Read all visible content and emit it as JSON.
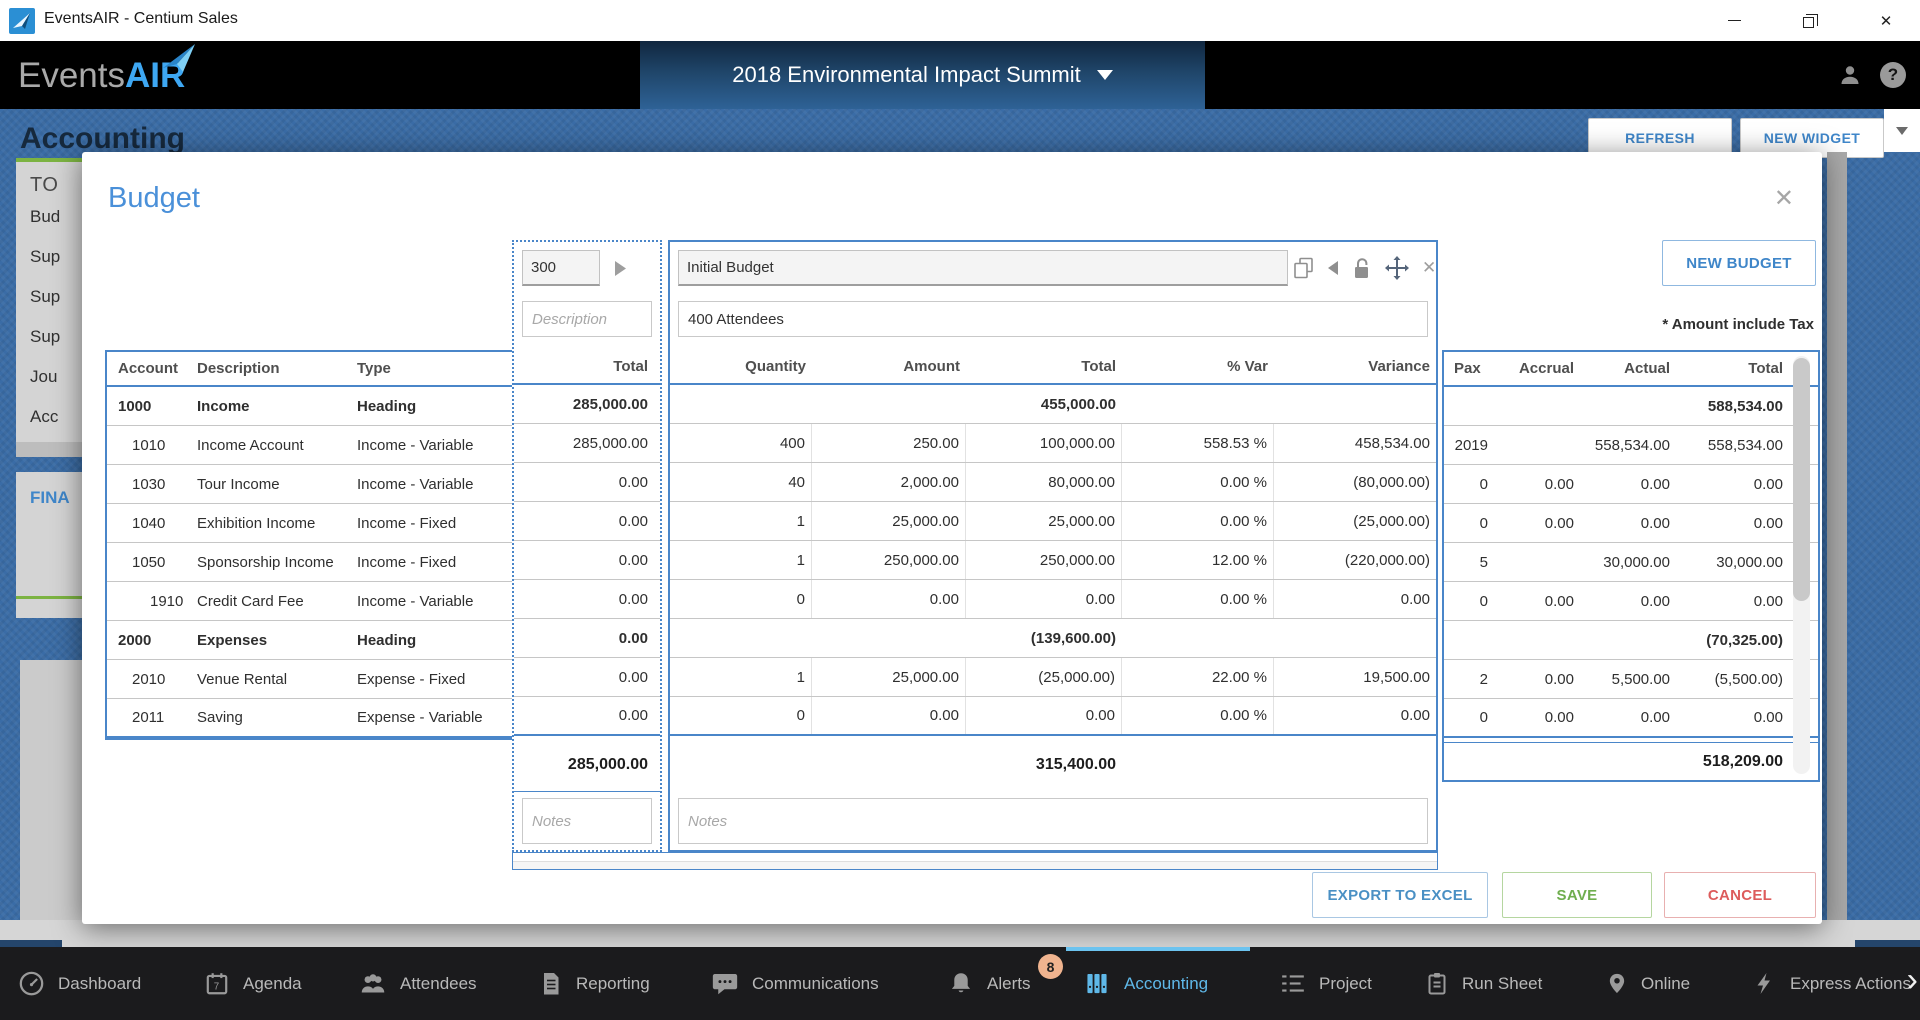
{
  "window": {
    "title": "EventsAIR - Centium Sales"
  },
  "app_header": {
    "logo_events": "Events",
    "logo_air": "AIR",
    "event_selector": "2018 Environmental Impact Summit"
  },
  "page": {
    "title": "Accounting",
    "refresh_label": "REFRESH",
    "new_widget_label": "NEW WIDGET",
    "left_cards": {
      "card1_heading": "TO",
      "card1_items": [
        "Bud",
        "Sup",
        "Sup",
        "Sup",
        "Jou",
        "Acc"
      ],
      "card2_heading": "FINA"
    }
  },
  "modal": {
    "title": "Budget",
    "close_glyph": "✕",
    "budget_code": "300",
    "budget_name": "Initial Budget",
    "budget_description": "400 Attendees",
    "description_placeholder": "Description",
    "notes_placeholder": "Notes",
    "new_budget_label": "NEW BUDGET",
    "tax_note": "* Amount include Tax",
    "buttons": {
      "export": "EXPORT TO EXCEL",
      "save": "SAVE",
      "cancel": "CANCEL"
    },
    "table": {
      "left_headers": [
        "Account",
        "Description",
        "Type"
      ],
      "total_header": "Total",
      "mid_headers": [
        "Quantity",
        "Amount",
        "Total",
        "% Var",
        "Variance"
      ],
      "right_headers": [
        "Pax",
        "Accrual",
        "Actual",
        "Total"
      ],
      "rows": [
        {
          "account": "1000",
          "description": "Income",
          "type": "Heading",
          "heading": true,
          "indent": 0,
          "total": "285,000.00",
          "qty": "",
          "amount": "",
          "mtotal": "455,000.00",
          "var_pct": "",
          "variance": "",
          "pax": "",
          "accrual": "",
          "actual": "",
          "rtotal": "588,534.00"
        },
        {
          "account": "1010",
          "description": "Income Account",
          "type": "Income - Variable",
          "heading": false,
          "indent": 1,
          "total": "285,000.00",
          "qty": "400",
          "amount": "250.00",
          "mtotal": "100,000.00",
          "var_pct": "558.53 %",
          "variance": "458,534.00",
          "pax": "2019",
          "accrual": "",
          "actual": "558,534.00",
          "rtotal": "558,534.00"
        },
        {
          "account": "1030",
          "description": "Tour Income",
          "type": "Income - Variable",
          "heading": false,
          "indent": 1,
          "total": "0.00",
          "qty": "40",
          "amount": "2,000.00",
          "mtotal": "80,000.00",
          "var_pct": "0.00 %",
          "variance": "(80,000.00)",
          "pax": "0",
          "accrual": "0.00",
          "actual": "0.00",
          "rtotal": "0.00"
        },
        {
          "account": "1040",
          "description": "Exhibition Income",
          "type": "Income - Fixed",
          "heading": false,
          "indent": 1,
          "total": "0.00",
          "qty": "1",
          "amount": "25,000.00",
          "mtotal": "25,000.00",
          "var_pct": "0.00 %",
          "variance": "(25,000.00)",
          "pax": "0",
          "accrual": "0.00",
          "actual": "0.00",
          "rtotal": "0.00"
        },
        {
          "account": "1050",
          "description": "Sponsorship Income",
          "type": "Income - Fixed",
          "heading": false,
          "indent": 1,
          "total": "0.00",
          "qty": "1",
          "amount": "250,000.00",
          "mtotal": "250,000.00",
          "var_pct": "12.00 %",
          "variance": "(220,000.00)",
          "pax": "5",
          "accrual": "",
          "actual": "30,000.00",
          "rtotal": "30,000.00"
        },
        {
          "account": "1910",
          "description": "Credit Card Fee",
          "type": "Income - Variable",
          "heading": false,
          "indent": 2,
          "total": "0.00",
          "qty": "0",
          "amount": "0.00",
          "mtotal": "0.00",
          "var_pct": "0.00 %",
          "variance": "0.00",
          "pax": "0",
          "accrual": "0.00",
          "actual": "0.00",
          "rtotal": "0.00"
        },
        {
          "account": "2000",
          "description": "Expenses",
          "type": "Heading",
          "heading": true,
          "indent": 0,
          "total": "0.00",
          "qty": "",
          "amount": "",
          "mtotal": "(139,600.00)",
          "var_pct": "",
          "variance": "",
          "pax": "",
          "accrual": "",
          "actual": "",
          "rtotal": "(70,325.00)"
        },
        {
          "account": "2010",
          "description": "Venue Rental",
          "type": "Expense - Fixed",
          "heading": false,
          "indent": 1,
          "total": "0.00",
          "qty": "1",
          "amount": "25,000.00",
          "mtotal": "(25,000.00)",
          "var_pct": "22.00 %",
          "variance": "19,500.00",
          "pax": "2",
          "accrual": "0.00",
          "actual": "5,500.00",
          "rtotal": "(5,500.00)"
        },
        {
          "account": "2011",
          "description": "Saving",
          "type": "Expense - Variable",
          "heading": false,
          "indent": 1,
          "total": "0.00",
          "qty": "0",
          "amount": "0.00",
          "mtotal": "0.00",
          "var_pct": "0.00 %",
          "variance": "0.00",
          "pax": "0",
          "accrual": "0.00",
          "actual": "0.00",
          "rtotal": "0.00"
        }
      ],
      "footer": {
        "total": "285,000.00",
        "mtotal": "315,400.00",
        "rtotal": "518,209.00"
      }
    }
  },
  "nav": {
    "items": [
      {
        "label": "Dashboard",
        "icon": "dashboard-icon",
        "active": false
      },
      {
        "label": "Agenda",
        "icon": "agenda-icon",
        "active": false
      },
      {
        "label": "Attendees",
        "icon": "attendees-icon",
        "active": false
      },
      {
        "label": "Reporting",
        "icon": "reporting-icon",
        "active": false
      },
      {
        "label": "Communications",
        "icon": "communications-icon",
        "active": false
      },
      {
        "label": "Alerts",
        "icon": "alerts-icon",
        "active": false
      },
      {
        "label": "Accounting",
        "icon": "accounting-icon",
        "active": true
      },
      {
        "label": "Project",
        "icon": "project-icon",
        "active": false
      },
      {
        "label": "Run Sheet",
        "icon": "run-sheet-icon",
        "active": false
      },
      {
        "label": "Online",
        "icon": "online-icon",
        "active": false
      },
      {
        "label": "Express Actions",
        "icon": "express-actions-icon",
        "active": false
      }
    ],
    "alerts_badge": "8",
    "more_chevron": "›"
  },
  "colors": {
    "accent_blue": "#4a86c9",
    "title_blue": "#4a90d9",
    "save_green": "#6fae4e",
    "cancel_red": "#dd5c5c",
    "nav_active": "#5fb8e8",
    "badge": "#f0b48f",
    "page_bg": "#3a6ca6"
  }
}
